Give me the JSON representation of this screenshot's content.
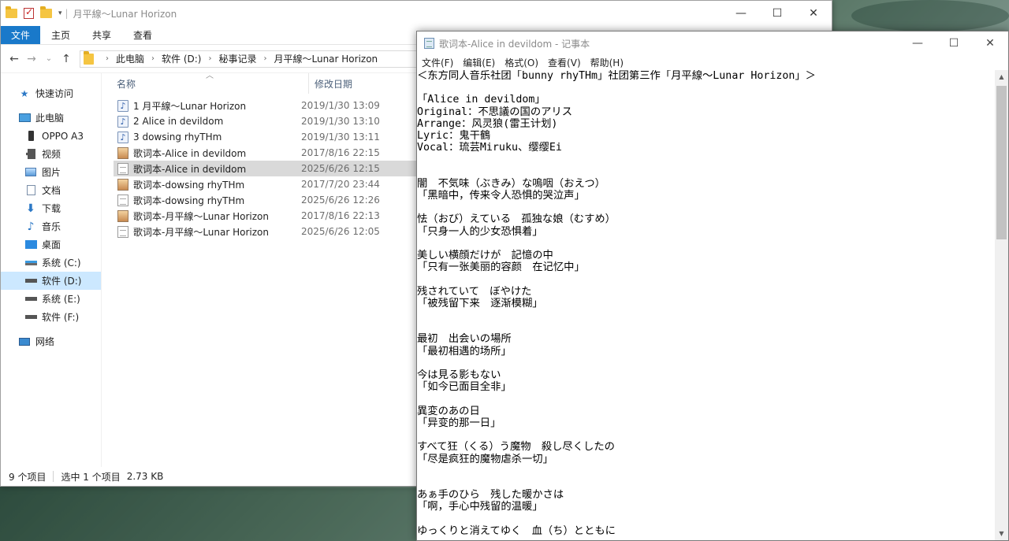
{
  "explorer": {
    "title": "月平線～Lunar Horizon",
    "window_controls": {
      "minimize": "—",
      "maximize": "☐",
      "close": "✕"
    },
    "ribbon_tabs": [
      "文件",
      "主页",
      "共享",
      "查看"
    ],
    "nav_buttons": {
      "back": "←",
      "forward": "→",
      "recent": "⌄",
      "up": "↑"
    },
    "breadcrumb": [
      "此电脑",
      "软件 (D:)",
      "秘事记录",
      "月平線～Lunar Horizon"
    ],
    "nav_pane": [
      {
        "label": "快速访问",
        "icon": "star-icon",
        "level": 0
      },
      {
        "label": "此电脑",
        "icon": "computer-icon",
        "level": 0
      },
      {
        "label": "OPPO A3",
        "icon": "phone-icon",
        "level": 1
      },
      {
        "label": "视频",
        "icon": "video-icon",
        "level": 1
      },
      {
        "label": "图片",
        "icon": "pictures-icon",
        "level": 1
      },
      {
        "label": "文档",
        "icon": "documents-icon",
        "level": 1
      },
      {
        "label": "下载",
        "icon": "download-icon",
        "level": 1
      },
      {
        "label": "音乐",
        "icon": "music-icon",
        "level": 1
      },
      {
        "label": "桌面",
        "icon": "desktop-icon",
        "level": 1
      },
      {
        "label": "系统 (C:)",
        "icon": "drive-icon",
        "level": 1
      },
      {
        "label": "软件 (D:)",
        "icon": "drive-icon",
        "level": 1,
        "selected": true
      },
      {
        "label": "系统 (E:)",
        "icon": "drive-icon",
        "level": 1
      },
      {
        "label": "软件 (F:)",
        "icon": "drive-icon",
        "level": 1
      },
      {
        "label": "网络",
        "icon": "network-icon",
        "level": 0
      }
    ],
    "columns": {
      "name": "名称",
      "date": "修改日期"
    },
    "files": [
      {
        "name": "1 月平線～Lunar Horizon",
        "date": "2019/1/30 13:09",
        "type": "audio"
      },
      {
        "name": "2 Alice in devildom",
        "date": "2019/1/30 13:10",
        "type": "audio"
      },
      {
        "name": "3 dowsing rhyTHm",
        "date": "2019/1/30 13:11",
        "type": "audio"
      },
      {
        "name": "歌词本-Alice in devildom",
        "date": "2017/8/16 22:15",
        "type": "image"
      },
      {
        "name": "歌词本-Alice in devildom",
        "date": "2025/6/26 12:15",
        "type": "text",
        "selected": true
      },
      {
        "name": "歌词本-dowsing rhyTHm",
        "date": "2017/7/20 23:44",
        "type": "image"
      },
      {
        "name": "歌词本-dowsing rhyTHm",
        "date": "2025/6/26 12:26",
        "type": "text"
      },
      {
        "name": "歌词本-月平線～Lunar Horizon",
        "date": "2017/8/16 22:13",
        "type": "image"
      },
      {
        "name": "歌词本-月平線～Lunar Horizon",
        "date": "2025/6/26 12:05",
        "type": "text"
      }
    ],
    "status": {
      "count": "9 个项目",
      "selection": "选中 1 个项目",
      "size": "2.73 KB"
    }
  },
  "notepad": {
    "title": "歌词本-Alice in devildom - 记事本",
    "window_controls": {
      "minimize": "—",
      "maximize": "☐",
      "close": "✕"
    },
    "menu": [
      "文件(F)",
      "编辑(E)",
      "格式(O)",
      "查看(V)",
      "帮助(H)"
    ],
    "content": "＜东方同人音乐社团「bunny rhyTHm」社团第三作「月平線～Lunar Horizon」＞\n\n「Alice in devildom」\nOriginal：不思議の国のアリス\nArrange：风灵狼(雷王计划)\nLyric：鬼干鶴\nVocal：琉芸Miruku、缨缨Ei\n\n\n闇　不気味（ぶきみ）な嗚咽（おえつ）\n「黑暗中，传来令人恐惧的哭泣声」\n\n怯（おび）えている　孤独な娘（むすめ）\n「只身一人的少女恐惧着」\n\n美しい横顔だけが　記憶の中\n「只有一张美丽的容颜　在记忆中」\n\n残されていて　ぼやけた\n「被残留下来　逐渐模糊」\n\n\n最初　出会いの場所\n「最初相遇的场所」\n\n今は見る影もない\n「如今已面目全非」\n\n異変のあの日\n「异变的那一日」\n\nすべて狂（くる）う魔物　殺し尽くしたの\n「尽是疯狂的魔物虐杀一切」\n\n\nあぁ手のひら　残した暖かさは\n「啊，手心中残留的温暖」\n\nゆっくりと消えてゆく　血（ち）とともに",
    "scroll_arrows": {
      "up": "▲",
      "down": "▼"
    }
  }
}
